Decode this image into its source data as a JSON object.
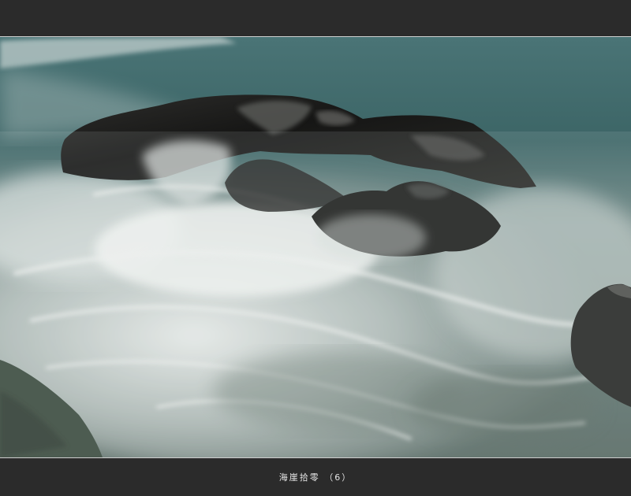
{
  "caption": "海崖拾零 （6）",
  "colors": {
    "frame": "#2b2b2b",
    "sea": "#3f6b6c",
    "foam": "#e4e8e6",
    "rock": "#1a1a1a"
  }
}
